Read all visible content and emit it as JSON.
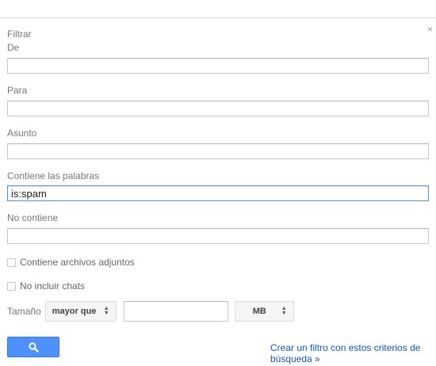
{
  "dialog": {
    "close_glyph": "×",
    "title": "Filtrar"
  },
  "fields": {
    "from_label": "De",
    "from_value": "",
    "to_label": "Para",
    "to_value": "",
    "subject_label": "Asunto",
    "subject_value": "",
    "has_words_label": "Contiene las palabras",
    "has_words_value": "is:spam",
    "not_words_label": "No contiene",
    "not_words_value": ""
  },
  "checkboxes": {
    "attachments_label": "Contiene archivos adjuntos",
    "attachments_checked": false,
    "no_chats_label": "No incluir chats",
    "no_chats_checked": false
  },
  "size": {
    "label": "Tamaño",
    "operator": "mayor que",
    "value": "",
    "unit": "MB"
  },
  "actions": {
    "search_icon": "search-icon",
    "create_filter_link": "Crear un filtro con estos criterios de búsqueda »"
  },
  "colors": {
    "accent": "#4d90fe",
    "link": "#1155cc"
  }
}
